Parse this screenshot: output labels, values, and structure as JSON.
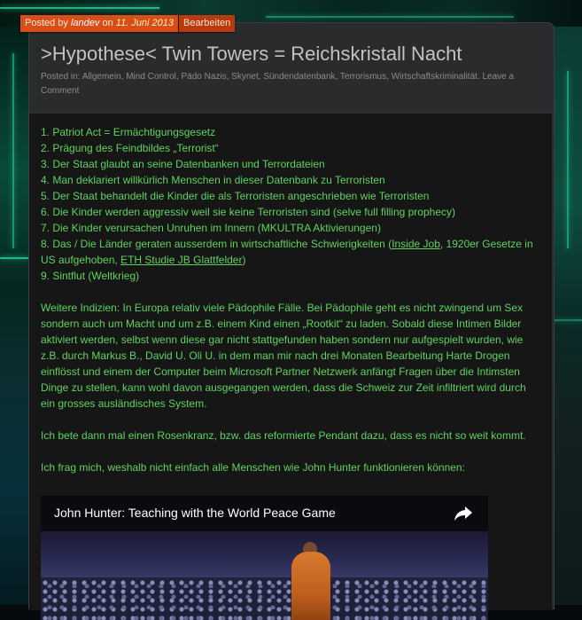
{
  "post": {
    "posted_by_prefix": "Posted by",
    "author": "landev",
    "on_word": "on",
    "date": "11. Juni 2013",
    "edit_label": "Bearbeiten",
    "title": ">Hypothese< Twin Towers = Reichskristall Nacht",
    "posted_in_label": "Posted in:",
    "categories": [
      "Allgemein",
      "Mind Control",
      "Pädo Nazis",
      "Skynet",
      "Sündendatenbank",
      "Terrorismus",
      "Wirtschaftskriminalität."
    ],
    "leave_comment": "Leave a Comment"
  },
  "list_items": [
    "1. Patriot Act = Ermächtigungsgesetz",
    "2. Prägung des Feindbildes „Terrorist“",
    "3. Der Staat glaubt an seine Datenbanken und Terrordateien",
    "4. Man deklariert willkürlich Menschen in dieser Datenbank zu Terroristen",
    "5. Der Staat behandelt die Kinder die als Terroristen angeschrieben wie Terroristen",
    "6. Die Kinder werden aggressiv weil sie keine Terroristen sind (selve full filling prophecy)",
    "7. Die Kinder verursachen Unruhen im Innern (MKULTRA Aktivierungen)"
  ],
  "item8": {
    "pre": "8. Das / Die Länder geraten ausserdem in wirtschaftliche Schwierigkeiten (",
    "link1": "Inside Job",
    "mid": ", 1920er Gesetze in US aufgehoben, ",
    "link2": "ETH Studie JB Glattfelder",
    "post": ")"
  },
  "item9": "9. Sintflut (Weltkrieg)",
  "paragraphs": [
    "Weitere Indizien: In Europa relativ viele Pädophile Fälle. Bei Pädophile geht es nicht zwingend um Sex sondern auch um Macht und um z.B. einem Kind einen „Rootkit“ zu laden. Sobald diese Intimen Bilder aktiviert werden, selbst wenn diese gar nicht stattgefunden haben sondern nur aufgespielt wurden, wie z.B. durch Markus B., David U. Oli U. in dem man mir nach drei Monaten Bearbeitung Harte Drogen einflösst und einem der Computer beim Microsoft Partner Netzwerk anfängt Fragen über die Intimsten Dinge zu stellen, kann wohl davon ausgegangen werden, dass die Schweiz zur Zeit infiltriert wird durch ein grosses ausländisches System.",
    "Ich bete dann mal einen Rosenkranz, bzw. das reformierte Pendant dazu, dass es nicht so weit kommt.",
    "Ich frag mich, weshalb nicht einfach alle Menschen wie John Hunter funktionieren können:"
  ],
  "video": {
    "title": "John Hunter: Teaching with the World Peace Game",
    "share_icon": "share-arrow-icon"
  },
  "colors": {
    "accent_orange": "#d84e16",
    "content_text_green": "#5fd35f",
    "title_gray": "#c2c2c2",
    "card_bg": "#2a2b2d",
    "inner_bg": "#161616"
  }
}
